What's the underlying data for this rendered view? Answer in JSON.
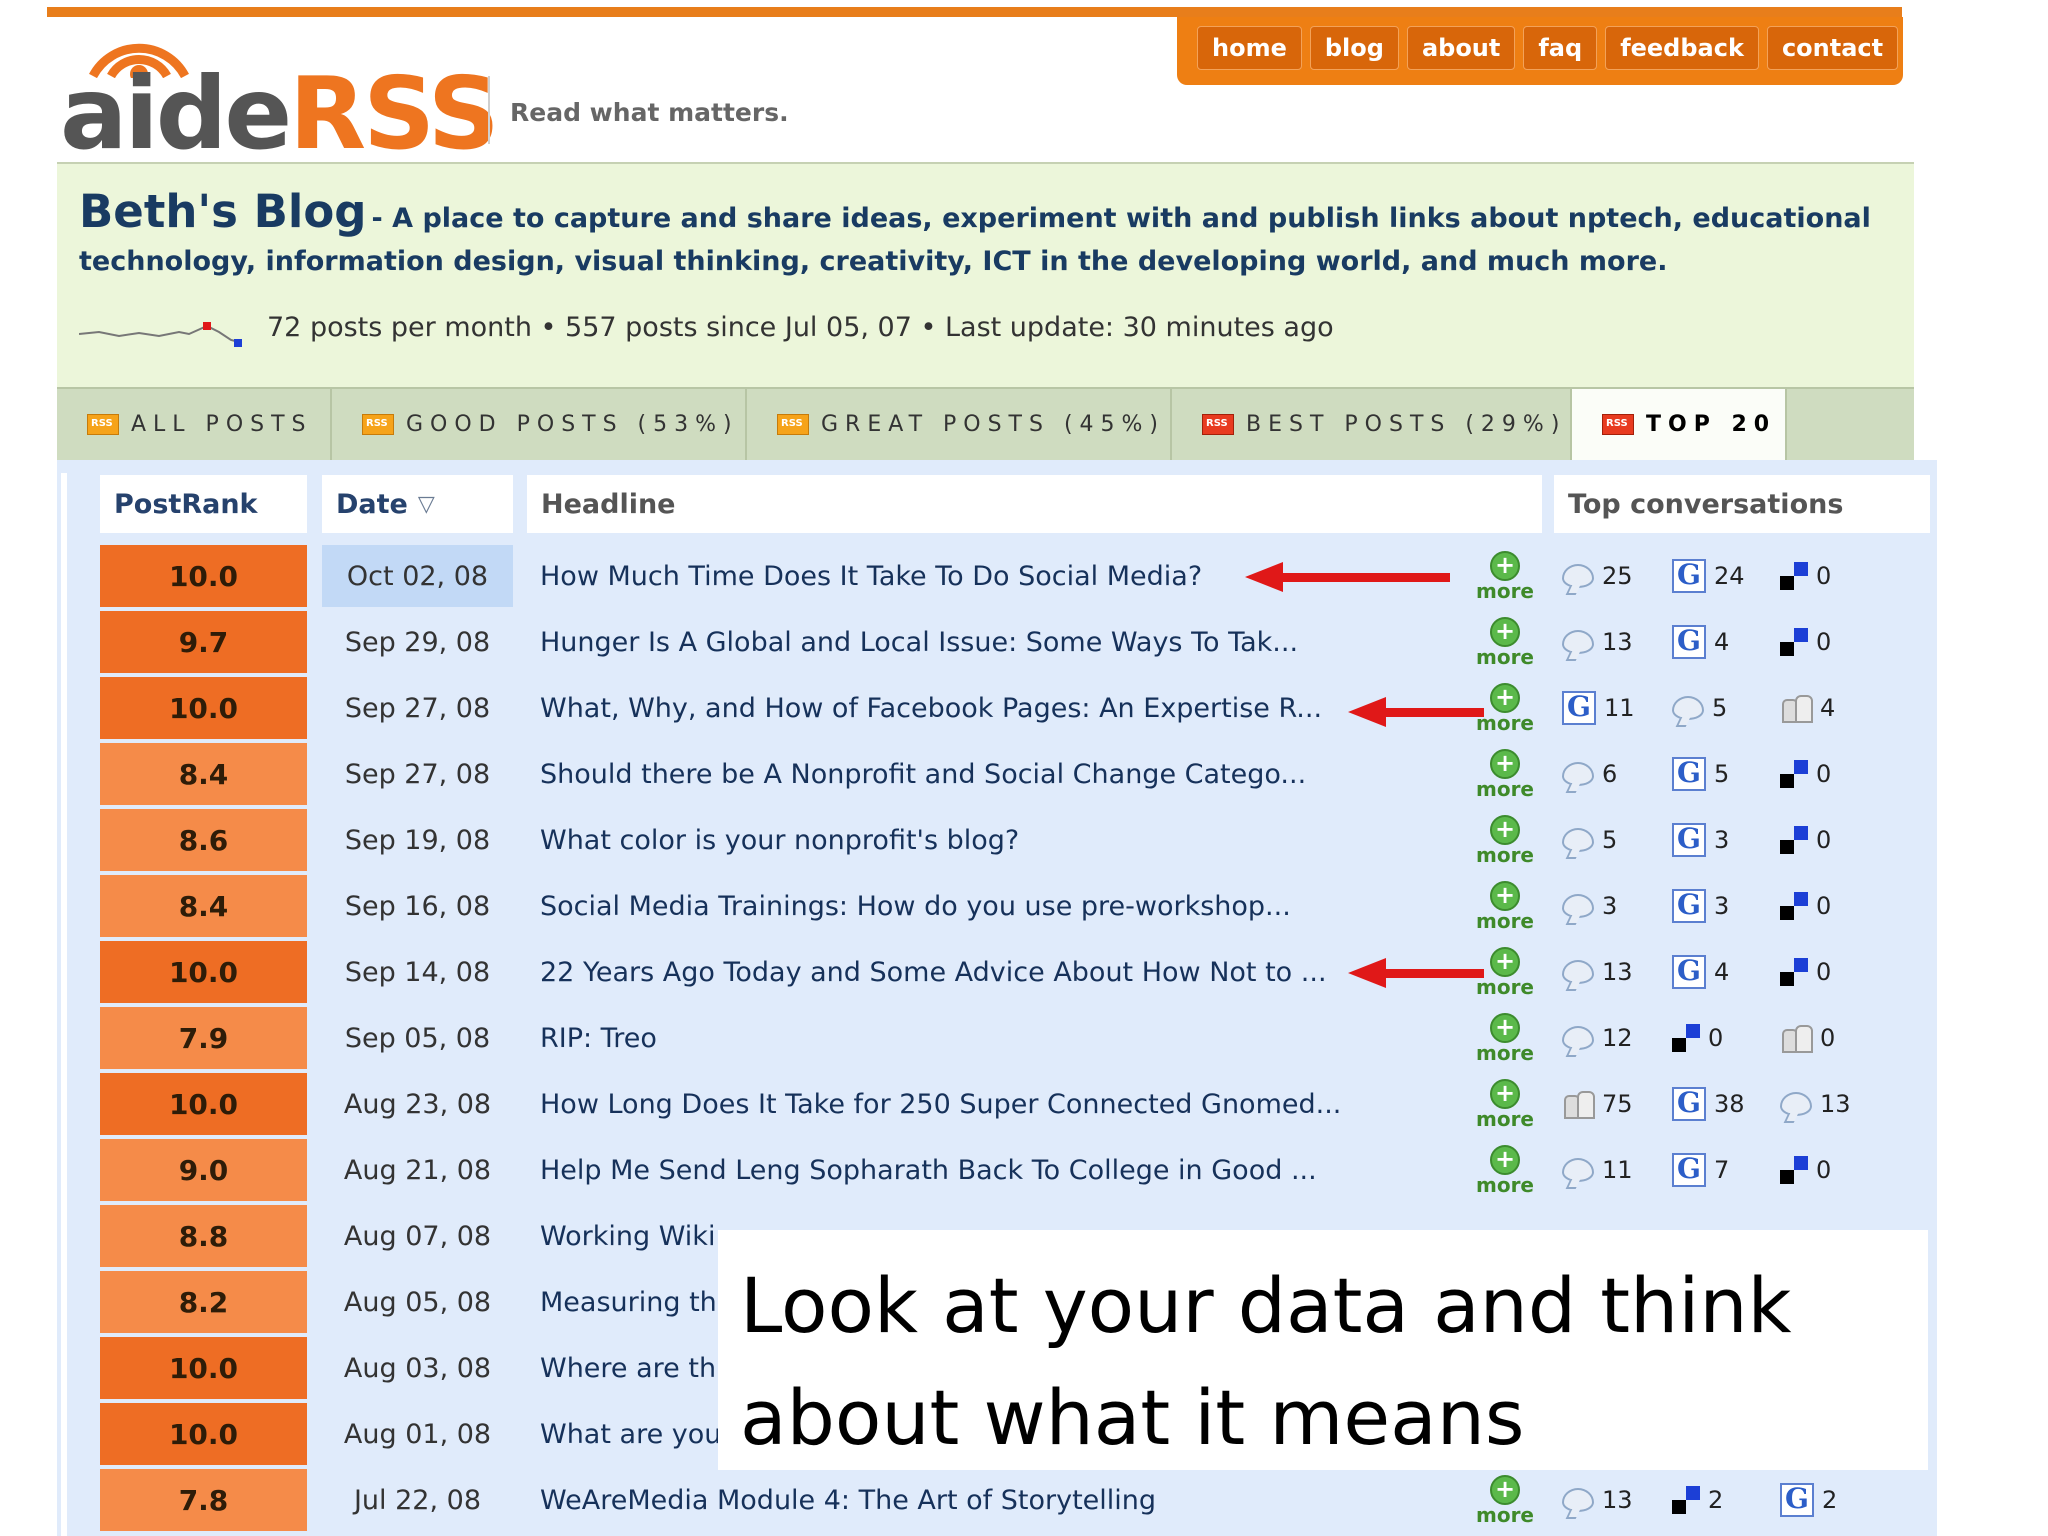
{
  "nav": {
    "items": [
      "home",
      "blog",
      "about",
      "faq",
      "feedback",
      "contact"
    ],
    "color": "#ee7f13"
  },
  "logo": {
    "aide": "aide",
    "rss": "RSS"
  },
  "tagline": "Read what matters.",
  "blog": {
    "name": "Beth's Blog",
    "description": "- A place to capture and share ideas, experiment with and publish links about nptech, educational technology, information design, visual thinking, creativity, ICT in the developing world, and much more.",
    "stats": "72 posts per month • 557 posts since Jul 05, 07 • Last update: 30 minutes ago"
  },
  "tabs": [
    {
      "label": "ALL POSTS"
    },
    {
      "label": "GOOD POSTS (53%)"
    },
    {
      "label": "GREAT POSTS (45%)"
    },
    {
      "label": "BEST POSTS (29%)"
    },
    {
      "label": "TOP 20"
    }
  ],
  "columns": {
    "postrank": "PostRank",
    "date": "Date",
    "headline": "Headline",
    "top_conversations": "Top conversations"
  },
  "more_label": "more",
  "rows": [
    {
      "rank": "10.0",
      "date": "Oct 02, 08",
      "headline": "How Much Time Does It Take To Do Social Media?",
      "conv": [
        {
          "icon": "comment-icon",
          "count": "25"
        },
        {
          "icon": "google-icon",
          "count": "24"
        },
        {
          "icon": "delicious-icon",
          "count": "0"
        }
      ]
    },
    {
      "rank": "9.7",
      "date": "Sep 29, 08",
      "headline": "Hunger Is A Global and Local Issue: Some Ways To Tak...",
      "conv": [
        {
          "icon": "comment-icon",
          "count": "13"
        },
        {
          "icon": "google-icon",
          "count": "4"
        },
        {
          "icon": "delicious-icon",
          "count": "0"
        }
      ]
    },
    {
      "rank": "10.0",
      "date": "Sep 27, 08",
      "headline": "What, Why, and How of Facebook Pages: An Expertise R...",
      "conv": [
        {
          "icon": "google-icon",
          "count": "11"
        },
        {
          "icon": "comment-icon",
          "count": "5"
        },
        {
          "icon": "people-icon",
          "count": "4"
        }
      ]
    },
    {
      "rank": "8.4",
      "date": "Sep 27, 08",
      "headline": "Should there be A Nonprofit and Social Change Catego...",
      "conv": [
        {
          "icon": "comment-icon",
          "count": "6"
        },
        {
          "icon": "google-icon",
          "count": "5"
        },
        {
          "icon": "delicious-icon",
          "count": "0"
        }
      ]
    },
    {
      "rank": "8.6",
      "date": "Sep 19, 08",
      "headline": "What color is your nonprofit's blog?",
      "conv": [
        {
          "icon": "comment-icon",
          "count": "5"
        },
        {
          "icon": "google-icon",
          "count": "3"
        },
        {
          "icon": "delicious-icon",
          "count": "0"
        }
      ]
    },
    {
      "rank": "8.4",
      "date": "Sep 16, 08",
      "headline": "Social Media Trainings: How do you use pre-workshop...",
      "conv": [
        {
          "icon": "comment-icon",
          "count": "3"
        },
        {
          "icon": "google-icon",
          "count": "3"
        },
        {
          "icon": "delicious-icon",
          "count": "0"
        }
      ]
    },
    {
      "rank": "10.0",
      "date": "Sep 14, 08",
      "headline": "22 Years Ago Today and Some Advice About How Not to ...",
      "conv": [
        {
          "icon": "comment-icon",
          "count": "13"
        },
        {
          "icon": "google-icon",
          "count": "4"
        },
        {
          "icon": "delicious-icon",
          "count": "0"
        }
      ]
    },
    {
      "rank": "7.9",
      "date": "Sep 05, 08",
      "headline": "RIP: Treo",
      "conv": [
        {
          "icon": "comment-icon",
          "count": "12"
        },
        {
          "icon": "delicious-icon",
          "count": "0"
        },
        {
          "icon": "people-icon",
          "count": "0"
        }
      ]
    },
    {
      "rank": "10.0",
      "date": "Aug 23, 08",
      "headline": "How Long Does It Take for 250 Super Connected Gnomed...",
      "conv": [
        {
          "icon": "people-icon",
          "count": "75"
        },
        {
          "icon": "google-icon",
          "count": "38"
        },
        {
          "icon": "comment-icon",
          "count": "13"
        }
      ]
    },
    {
      "rank": "9.0",
      "date": "Aug 21, 08",
      "headline": "Help Me Send Leng Sopharath Back To College in Good ...",
      "conv": [
        {
          "icon": "comment-icon",
          "count": "11"
        },
        {
          "icon": "google-icon",
          "count": "7"
        },
        {
          "icon": "delicious-icon",
          "count": "0"
        }
      ]
    },
    {
      "rank": "8.8",
      "date": "Aug 07, 08",
      "headline": "Working Wiki",
      "conv": []
    },
    {
      "rank": "8.2",
      "date": "Aug 05, 08",
      "headline": "Measuring th",
      "conv": []
    },
    {
      "rank": "10.0",
      "date": "Aug 03, 08",
      "headline": "Where are th",
      "conv": []
    },
    {
      "rank": "10.0",
      "date": "Aug 01, 08",
      "headline": "What are you",
      "conv": []
    },
    {
      "rank": "7.8",
      "date": "Jul 22, 08",
      "headline": "WeAreMedia Module 4: The Art of Storytelling",
      "conv": [
        {
          "icon": "comment-icon",
          "count": "13"
        },
        {
          "icon": "delicious-icon",
          "count": "2"
        },
        {
          "icon": "google-icon",
          "count": "2"
        }
      ]
    }
  ],
  "caption": "Look at  your data and think about what it means",
  "colors": {
    "rank_high": "#ee6d24",
    "rank_low": "#f58b49",
    "arrow": "#e01818",
    "accent": "#ee7f13"
  }
}
